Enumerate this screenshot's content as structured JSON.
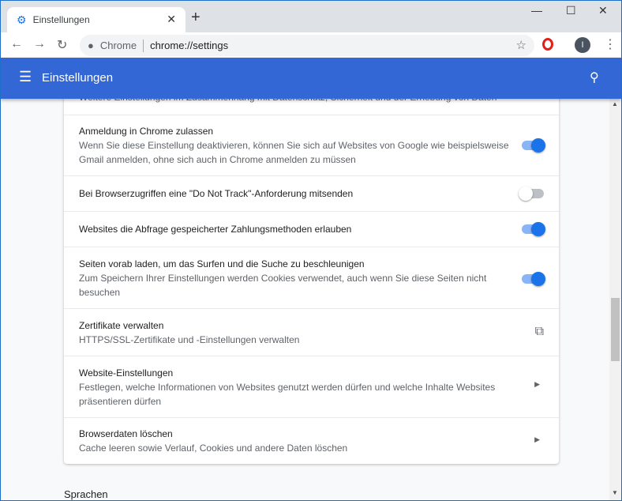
{
  "browser": {
    "tab_title": "Einstellungen",
    "omnibox_label": "Chrome",
    "url": "chrome://settings",
    "avatar_letter": "I"
  },
  "header": {
    "title": "Einstellungen"
  },
  "card": {
    "clipped_text": "Weitere Einstellungen im Zusammenhang mit Datenschutz, Sicherheit und der Erhebung von Daten",
    "rows": [
      {
        "title": "Anmeldung in Chrome zulassen",
        "desc": "Wenn Sie diese Einstellung deaktivieren, können Sie sich auf Websites von Google wie beispielsweise Gmail anmelden, ohne sich auch in Chrome anmelden zu müssen",
        "control": "toggle",
        "on": true
      },
      {
        "title": "Bei Browserzugriffen eine \"Do Not Track\"-Anforderung mitsenden",
        "control": "toggle",
        "on": false
      },
      {
        "title": "Websites die Abfrage gespeicherter Zahlungsmethoden erlauben",
        "control": "toggle",
        "on": true
      },
      {
        "title": "Seiten vorab laden, um das Surfen und die Suche zu beschleunigen",
        "desc": "Zum Speichern Ihrer Einstellungen werden Cookies verwendet, auch wenn Sie diese Seiten nicht besuchen",
        "control": "toggle",
        "on": true
      },
      {
        "title": "Zertifikate verwalten",
        "desc": "HTTPS/SSL-Zertifikate und -Einstellungen verwalten",
        "control": "external-link-icon"
      },
      {
        "title": "Website-Einstellungen",
        "desc": "Festlegen, welche Informationen von Websites genutzt werden dürfen und welche Inhalte Websites präsentieren dürfen",
        "control": "arrow-right-icon"
      },
      {
        "title": "Browserdaten löschen",
        "desc": "Cache leeren sowie Verlauf, Cookies und andere Daten löschen",
        "control": "arrow-right-icon"
      }
    ]
  },
  "section_next": "Sprachen",
  "colors": {
    "header": "#3367d6",
    "toggle_on": "#1a73e8"
  }
}
